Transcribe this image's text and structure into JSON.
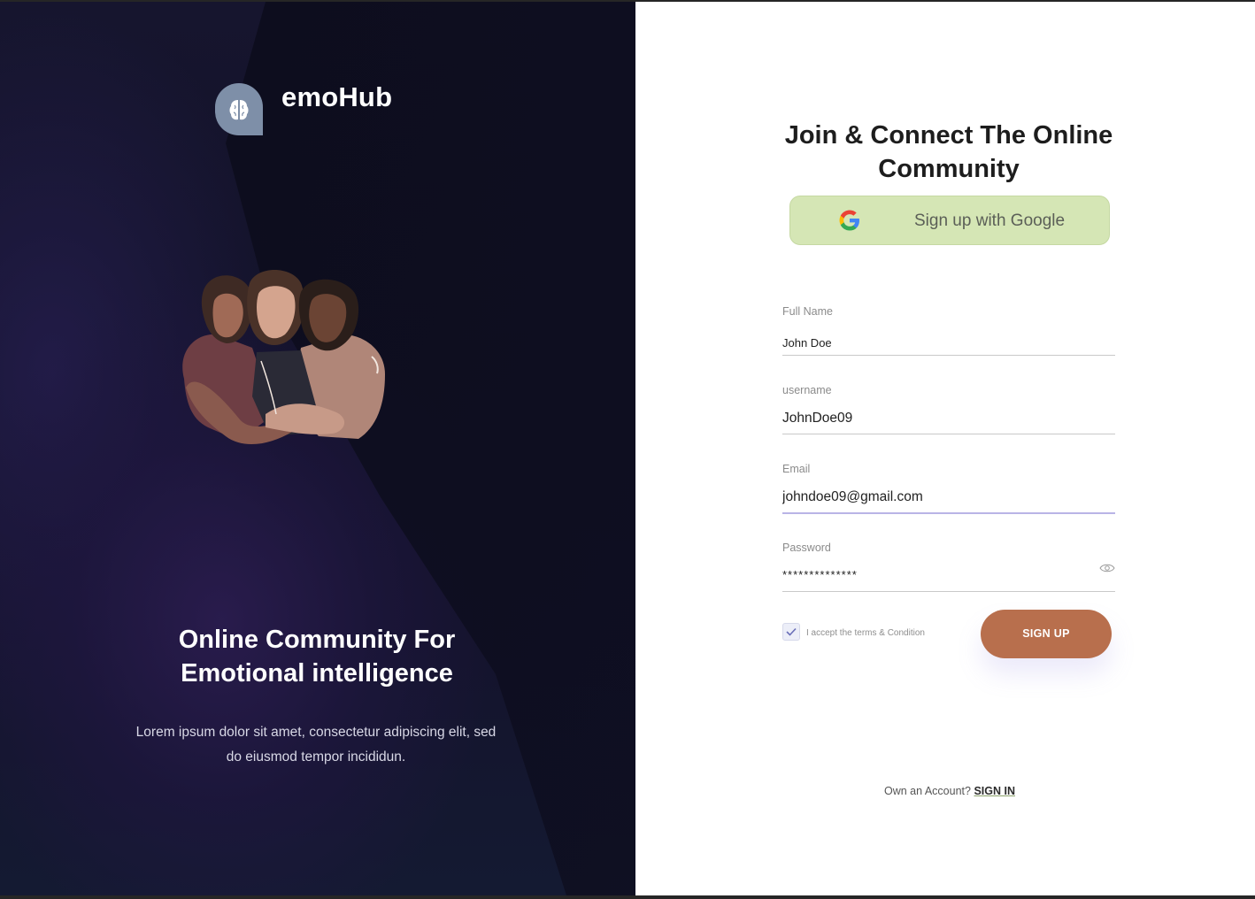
{
  "brand": {
    "name": "emoHub",
    "logo_color": "#7e8fa8"
  },
  "hero": {
    "heading": "Online Community For\nEmotional intelligence",
    "subtext": "Lorem ipsum dolor sit amet, consectetur adipiscing elit, sed do eiusmod tempor incididun."
  },
  "form": {
    "title": "Join & Connect The Online Community",
    "google_button_label": "Sign up with Google",
    "full_name": {
      "label": "Full Name",
      "value": "John Doe"
    },
    "username": {
      "label": "username",
      "value": "JohnDoe09"
    },
    "email": {
      "label": "Email",
      "value": "johndoe09@gmail.com"
    },
    "password": {
      "label": "Password",
      "value": "**************"
    },
    "terms_label": "I accept the terms & Condition",
    "terms_checked": true,
    "submit_label": "SIGN UP",
    "signin_prompt": "Own an Account?",
    "signin_link": "SIGN IN"
  },
  "colors": {
    "left_bg": "#14132c",
    "google_button": "#d5e6b5",
    "signup_button": "#b86f4d",
    "email_underline_focus": "#b9b4e6"
  },
  "icons": {
    "logo": "brain-icon",
    "google": "google-icon",
    "password_toggle": "eye-icon",
    "checkbox": "checkmark-icon"
  }
}
